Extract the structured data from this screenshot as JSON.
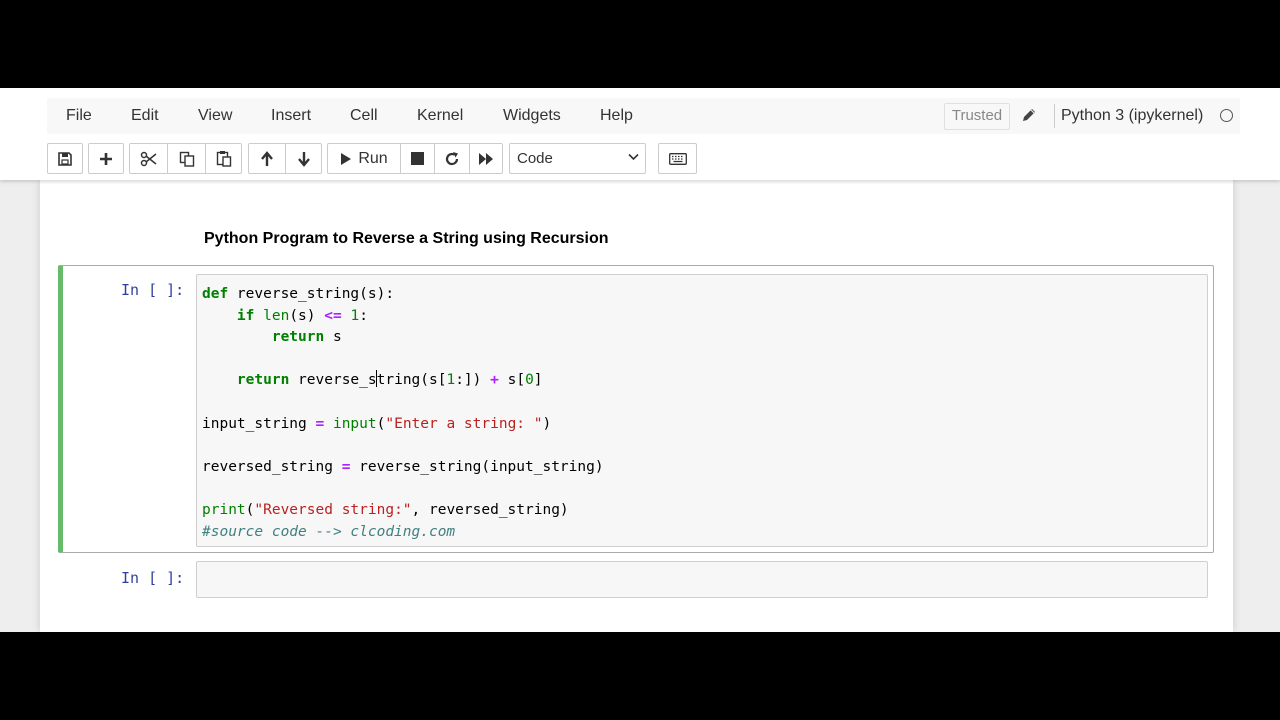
{
  "menu": {
    "items": [
      "File",
      "Edit",
      "View",
      "Insert",
      "Cell",
      "Kernel",
      "Widgets",
      "Help"
    ],
    "trusted_label": "Trusted",
    "kernel_name": "Python 3 (ipykernel)"
  },
  "toolbar": {
    "run_label": "Run",
    "cell_type": "Code",
    "icons": [
      "save-icon",
      "plus-icon",
      "scissors-icon",
      "copy-icon",
      "paste-icon",
      "arrow-up-icon",
      "arrow-down-icon",
      "play-icon",
      "stop-icon",
      "restart-icon",
      "fast-forward-icon",
      "keyboard-icon"
    ]
  },
  "notebook": {
    "heading": "Python Program to Reverse a String using Recursion",
    "cells": [
      {
        "prompt": "In [ ]:",
        "code_lines": [
          "def reverse_string(s):",
          "    if len(s) <= 1:",
          "        return s",
          "",
          "    return reverse_string(s[1:]) + s[0]",
          "",
          "input_string = input(\"Enter a string: \")",
          "",
          "reversed_string = reverse_string(input_string)",
          "",
          "print(\"Reversed string:\", reversed_string)",
          "#source code --> clcoding.com"
        ]
      },
      {
        "prompt": "In [ ]:",
        "code_lines": []
      }
    ]
  },
  "colors": {
    "selected_cell_border": "#66bb6a",
    "prompt": "#303f9f",
    "keyword": "#008000",
    "operator": "#aa22ff",
    "string": "#ba2121",
    "comment": "#408080"
  }
}
